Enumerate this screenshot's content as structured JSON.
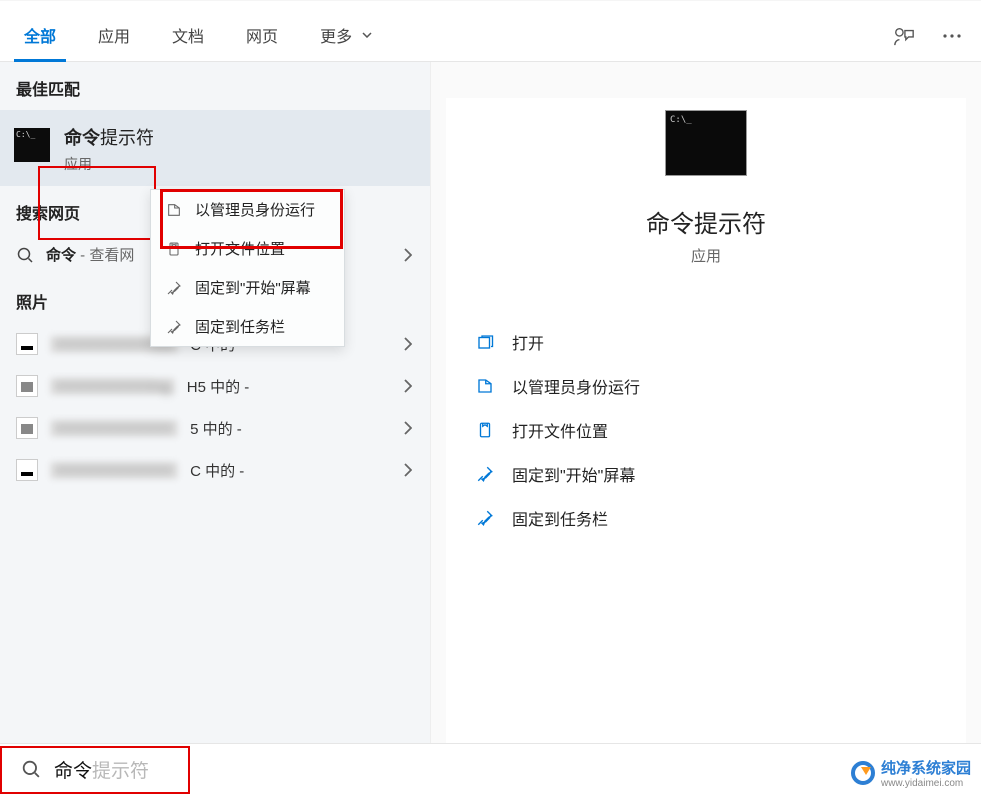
{
  "tabs": {
    "all": "全部",
    "apps": "应用",
    "docs": "文档",
    "web": "网页",
    "more": "更多"
  },
  "sections": {
    "best_match": "最佳匹配",
    "web_search": "搜索网页",
    "photos": "照片"
  },
  "best_match": {
    "title_bold": "命令",
    "title_rest": "提示符",
    "subtitle": "应用"
  },
  "context_menu": {
    "run_admin": "以管理员身份运行",
    "open_location": "打开文件位置",
    "pin_start": "固定到\"开始\"屏幕",
    "pin_taskbar": "固定到任务栏"
  },
  "web_row": {
    "term_bold": "命令",
    "suffix": " - 查看网"
  },
  "photo_rows": [
    {
      "suffix": "C 中的 -"
    },
    {
      "suffix": "H5 中的 -"
    },
    {
      "suffix": "5 中的 -"
    },
    {
      "suffix": "C 中的 -"
    }
  ],
  "detail": {
    "title": "命令提示符",
    "subtitle": "应用",
    "actions": {
      "open": "打开",
      "run_admin": "以管理员身份运行",
      "open_location": "打开文件位置",
      "pin_start": "固定到\"开始\"屏幕",
      "pin_taskbar": "固定到任务栏"
    }
  },
  "searchbar": {
    "typed": "命令",
    "ghost": "提示符"
  },
  "watermark": {
    "title": "纯净系统家园",
    "url": "www.yidaimei.com"
  }
}
